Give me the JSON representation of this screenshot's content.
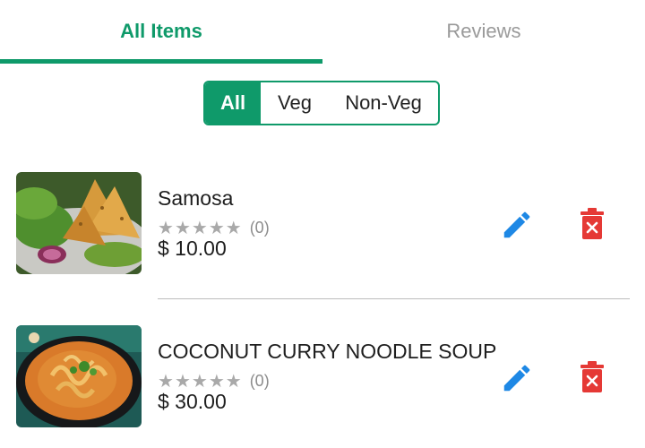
{
  "tabs": [
    {
      "label": "All Items",
      "active": true
    },
    {
      "label": "Reviews",
      "active": false
    }
  ],
  "filter": {
    "options": [
      "All",
      "Veg",
      "Non-Veg"
    ],
    "selected": "All"
  },
  "items": [
    {
      "name": "Samosa",
      "rating_stars": 0,
      "rating_count_label": "(0)",
      "price": "$ 10.00",
      "image": "samosa-photo"
    },
    {
      "name": "COCONUT CURRY NOODLE SOUP",
      "rating_stars": 0,
      "rating_count_label": "(0)",
      "price": "$ 30.00",
      "image": "curry-noodle-soup-photo"
    }
  ],
  "icons": {
    "edit": "pencil-icon",
    "delete": "trash-icon",
    "star": "star-icon"
  },
  "colors": {
    "accent": "#0f9a6a",
    "edit_icon": "#1e88e5",
    "delete_icon": "#e53935",
    "inactive_text": "#9a9a9a",
    "star": "#a9a9a9"
  }
}
